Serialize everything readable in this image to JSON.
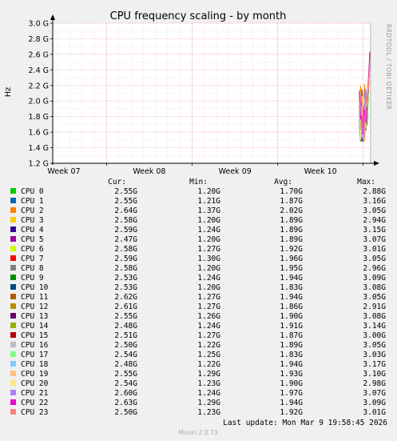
{
  "chart_data": {
    "type": "line",
    "title": "CPU frequency scaling - by month",
    "ylabel": "Hz",
    "ylim": [
      1.2,
      3.0
    ],
    "yticks": [
      "1.2 G",
      "1.4 G",
      "1.6 G",
      "1.8 G",
      "2.0 G",
      "2.2 G",
      "2.4 G",
      "2.6 G",
      "2.8 G",
      "3.0 G"
    ],
    "yticks_values": [
      1.2,
      1.4,
      1.6,
      1.8,
      2.0,
      2.2,
      2.4,
      2.6,
      2.8,
      3.0
    ],
    "xticks": [
      "Week 07",
      "Week 08",
      "Week 09",
      "Week 10"
    ],
    "xticks_pos": [
      0.169,
      0.437,
      0.706,
      0.974
    ],
    "grid": true,
    "watermark": "RRDTOOL / TOBI OETIKER",
    "legend_header": {
      "cur": "Cur:",
      "min": "Min:",
      "avg": "Avg:",
      "max": "Max:"
    },
    "series": [
      {
        "name": "CPU 0",
        "color": "#00cc00",
        "cur": "2.55G",
        "min": "1.20G",
        "avg": "1.70G",
        "max": "2.88G"
      },
      {
        "name": "CPU 1",
        "color": "#0066b3",
        "cur": "2.55G",
        "min": "1.21G",
        "avg": "1.87G",
        "max": "3.16G"
      },
      {
        "name": "CPU 2",
        "color": "#ff8000",
        "cur": "2.64G",
        "min": "1.37G",
        "avg": "2.02G",
        "max": "3.05G"
      },
      {
        "name": "CPU 3",
        "color": "#ffcc00",
        "cur": "2.58G",
        "min": "1.20G",
        "avg": "1.89G",
        "max": "2.94G"
      },
      {
        "name": "CPU 4",
        "color": "#330099",
        "cur": "2.59G",
        "min": "1.24G",
        "avg": "1.89G",
        "max": "3.15G"
      },
      {
        "name": "CPU 5",
        "color": "#990099",
        "cur": "2.47G",
        "min": "1.20G",
        "avg": "1.89G",
        "max": "3.07G"
      },
      {
        "name": "CPU 6",
        "color": "#ccff00",
        "cur": "2.58G",
        "min": "1.27G",
        "avg": "1.92G",
        "max": "3.01G"
      },
      {
        "name": "CPU 7",
        "color": "#ff0000",
        "cur": "2.59G",
        "min": "1.30G",
        "avg": "1.96G",
        "max": "3.05G"
      },
      {
        "name": "CPU 8",
        "color": "#808080",
        "cur": "2.58G",
        "min": "1.20G",
        "avg": "1.95G",
        "max": "2.96G"
      },
      {
        "name": "CPU 9",
        "color": "#008f00",
        "cur": "2.53G",
        "min": "1.24G",
        "avg": "1.94G",
        "max": "3.09G"
      },
      {
        "name": "CPU 10",
        "color": "#00487d",
        "cur": "2.53G",
        "min": "1.20G",
        "avg": "1.83G",
        "max": "3.08G"
      },
      {
        "name": "CPU 11",
        "color": "#b35a00",
        "cur": "2.62G",
        "min": "1.27G",
        "avg": "1.94G",
        "max": "3.05G"
      },
      {
        "name": "CPU 12",
        "color": "#b38f00",
        "cur": "2.61G",
        "min": "1.27G",
        "avg": "1.86G",
        "max": "2.91G"
      },
      {
        "name": "CPU 13",
        "color": "#6b006b",
        "cur": "2.55G",
        "min": "1.26G",
        "avg": "1.90G",
        "max": "3.08G"
      },
      {
        "name": "CPU 14",
        "color": "#8fb300",
        "cur": "2.48G",
        "min": "1.24G",
        "avg": "1.91G",
        "max": "3.14G"
      },
      {
        "name": "CPU 15",
        "color": "#b30000",
        "cur": "2.51G",
        "min": "1.27G",
        "avg": "1.87G",
        "max": "3.00G"
      },
      {
        "name": "CPU 16",
        "color": "#bebebe",
        "cur": "2.50G",
        "min": "1.22G",
        "avg": "1.89G",
        "max": "3.05G"
      },
      {
        "name": "CPU 17",
        "color": "#80ff80",
        "cur": "2.54G",
        "min": "1.25G",
        "avg": "1.83G",
        "max": "3.03G"
      },
      {
        "name": "CPU 18",
        "color": "#80c9ff",
        "cur": "2.48G",
        "min": "1.22G",
        "avg": "1.94G",
        "max": "3.17G"
      },
      {
        "name": "CPU 19",
        "color": "#ffc080",
        "cur": "2.55G",
        "min": "1.29G",
        "avg": "1.93G",
        "max": "3.10G"
      },
      {
        "name": "CPU 20",
        "color": "#ffe680",
        "cur": "2.54G",
        "min": "1.23G",
        "avg": "1.90G",
        "max": "2.98G"
      },
      {
        "name": "CPU 21",
        "color": "#aa80ff",
        "cur": "2.60G",
        "min": "1.24G",
        "avg": "1.97G",
        "max": "3.07G"
      },
      {
        "name": "CPU 22",
        "color": "#ee00cc",
        "cur": "2.63G",
        "min": "1.29G",
        "avg": "1.94G",
        "max": "3.09G"
      },
      {
        "name": "CPU 23",
        "color": "#ff8080",
        "cur": "2.50G",
        "min": "1.23G",
        "avg": "1.92G",
        "max": "3.01G"
      }
    ]
  },
  "last_update": "Last update: Mon Mar  9 19:58:45 2026",
  "footer": "Munin 2.0.73"
}
